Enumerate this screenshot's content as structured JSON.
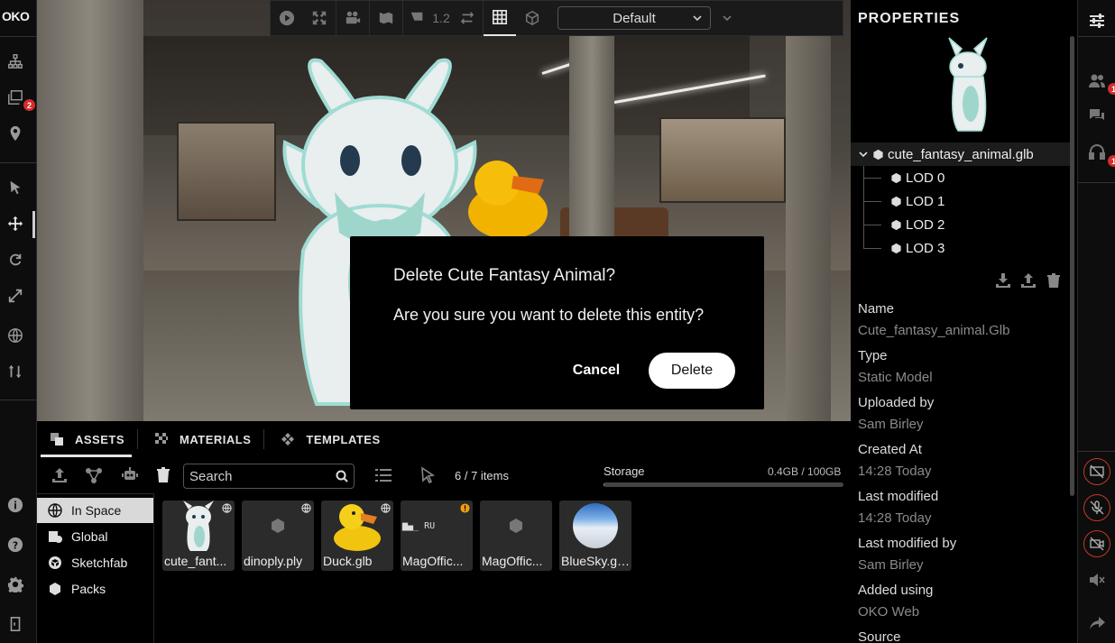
{
  "app": {
    "logo": "OKO"
  },
  "left_rail": {
    "badge_count": "2",
    "items": [
      "hierarchy-icon",
      "layers-icon",
      "location-pin-icon",
      "select-cursor-icon",
      "move-icon",
      "rotate-icon",
      "scale-icon",
      "globe-icon",
      "sort-icon",
      "info-icon",
      "help-icon",
      "settings-icon",
      "exit-icon"
    ]
  },
  "viewport_toolbar": {
    "speed": "1.2",
    "camera_select": "Default"
  },
  "dialog": {
    "title": "Delete Cute Fantasy Animal?",
    "body": "Are you sure you want to delete this entity?",
    "cancel_label": "Cancel",
    "delete_label": "Delete"
  },
  "asset_panel": {
    "tabs": [
      {
        "label": "ASSETS",
        "icon": "assets-icon",
        "active": true
      },
      {
        "label": "MATERIALS",
        "icon": "materials-icon",
        "active": false
      },
      {
        "label": "TEMPLATES",
        "icon": "templates-icon",
        "active": false
      }
    ],
    "search_placeholder": "Search",
    "item_count": "6 / 7 items",
    "storage_label": "Storage",
    "storage_value": "0.4GB / 100GB",
    "storage_fraction": 0.004,
    "sources": [
      {
        "label": "In Space",
        "icon": "globe-icon",
        "active": true
      },
      {
        "label": "Global",
        "icon": "global-library-icon",
        "active": false
      },
      {
        "label": "Sketchfab",
        "icon": "sketchfab-icon",
        "active": false
      },
      {
        "label": "Packs",
        "icon": "pack-icon",
        "active": false
      }
    ],
    "assets": [
      {
        "name": "cute_fant...",
        "thumb": "creature",
        "corner": "globe-icon"
      },
      {
        "name": "dinoply.ply",
        "thumb": "cube",
        "corner": "globe-icon"
      },
      {
        "name": "Duck.glb",
        "thumb": "duck",
        "corner": "globe-icon"
      },
      {
        "name": "MagOffic...",
        "thumb": "text",
        "thumb_text": "▆▄_ RU",
        "corner": "warning-icon"
      },
      {
        "name": "MagOffic...",
        "thumb": "cube",
        "corner": ""
      },
      {
        "name": "BlueSky.gl...",
        "thumb": "sky",
        "corner": ""
      }
    ]
  },
  "properties": {
    "title": "PROPERTIES",
    "tree_root": "cute_fantasy_animal.glb",
    "lods": [
      "LOD 0",
      "LOD 1",
      "LOD 2",
      "LOD 3"
    ],
    "fields": [
      {
        "label": "Name",
        "value": "Cute_fantasy_animal.Glb"
      },
      {
        "label": "Type",
        "value": "Static Model"
      },
      {
        "label": "Uploaded by",
        "value": "Sam Birley"
      },
      {
        "label": "Created At",
        "value": "14:28 Today"
      },
      {
        "label": "Last modified",
        "value": "14:28 Today"
      },
      {
        "label": "Last modified by",
        "value": "Sam Birley"
      },
      {
        "label": "Added using",
        "value": "OKO Web"
      },
      {
        "label": "Source",
        "value": ""
      }
    ]
  },
  "right_rail": {
    "users_badge": "1",
    "audio_badge": "1"
  },
  "colors": {
    "badge": "#d72b2b",
    "muted_ring": "#c0392b",
    "active_source_bg": "#d9d9d9"
  }
}
